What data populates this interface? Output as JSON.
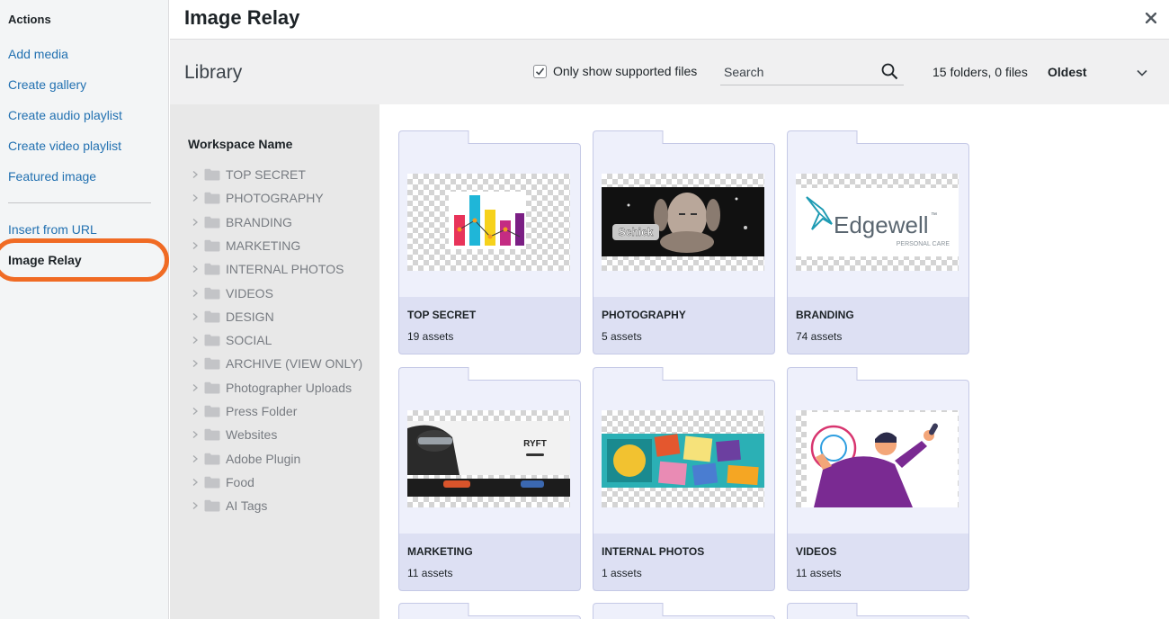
{
  "menu": {
    "title": "Actions",
    "items": [
      {
        "label": "Add media"
      },
      {
        "label": "Create gallery"
      },
      {
        "label": "Create audio playlist"
      },
      {
        "label": "Create video playlist"
      },
      {
        "label": "Featured image"
      },
      {
        "label": "Insert from URL"
      },
      {
        "label": "Image Relay"
      }
    ],
    "active_item": "Image Relay"
  },
  "header": {
    "title": "Image Relay",
    "close_icon": "close-icon"
  },
  "toolbar": {
    "library_title": "Library",
    "supported_checkbox_label": "Only show supported files",
    "supported_checked": true,
    "search_placeholder": "Search",
    "count_text": "15 folders, 0 files",
    "sort_value": "Oldest"
  },
  "tree": {
    "workspace_name": "Workspace Name",
    "folders": [
      "TOP SECRET",
      "PHOTOGRAPHY",
      "BRANDING",
      "MARKETING",
      "INTERNAL PHOTOS",
      "VIDEOS",
      "DESIGN",
      "SOCIAL",
      "ARCHIVE (VIEW ONLY)",
      "Photographer Uploads",
      "Press Folder",
      "Websites",
      "Adobe Plugin",
      "Food",
      "AI Tags"
    ]
  },
  "grid": {
    "cards": [
      {
        "name": "TOP SECRET",
        "count": "19 assets",
        "thumb": "bar-chart"
      },
      {
        "name": "PHOTOGRAPHY",
        "count": "5 assets",
        "thumb": "schick-photo"
      },
      {
        "name": "BRANDING",
        "count": "74 assets",
        "thumb": "edgewell-logo",
        "logo_text": "Edgewell",
        "logo_tm": "™",
        "logo_sub": "PERSONAL CARE"
      },
      {
        "name": "MARKETING",
        "count": "11 assets",
        "thumb": "ryft-banner",
        "banner_text": "RYFT"
      },
      {
        "name": "INTERNAL PHOTOS",
        "count": "1 assets",
        "thumb": "passport-collage"
      },
      {
        "name": "VIDEOS",
        "count": "11 assets",
        "thumb": "illustration"
      }
    ]
  },
  "colors": {
    "link": "#2271b1",
    "highlight_ring": "#f06b24",
    "card_fill": "#eef0fb",
    "card_footer": "#dde0f3",
    "card_border": "#c5c9e6"
  }
}
